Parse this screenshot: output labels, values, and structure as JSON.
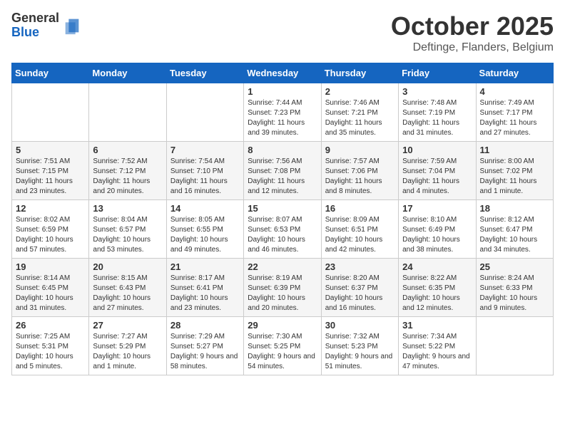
{
  "logo": {
    "general": "General",
    "blue": "Blue"
  },
  "header": {
    "month": "October 2025",
    "location": "Deftinge, Flanders, Belgium"
  },
  "days_of_week": [
    "Sunday",
    "Monday",
    "Tuesday",
    "Wednesday",
    "Thursday",
    "Friday",
    "Saturday"
  ],
  "weeks": [
    [
      {
        "day": "",
        "info": ""
      },
      {
        "day": "",
        "info": ""
      },
      {
        "day": "",
        "info": ""
      },
      {
        "day": "1",
        "info": "Sunrise: 7:44 AM\nSunset: 7:23 PM\nDaylight: 11 hours\nand 39 minutes."
      },
      {
        "day": "2",
        "info": "Sunrise: 7:46 AM\nSunset: 7:21 PM\nDaylight: 11 hours\nand 35 minutes."
      },
      {
        "day": "3",
        "info": "Sunrise: 7:48 AM\nSunset: 7:19 PM\nDaylight: 11 hours\nand 31 minutes."
      },
      {
        "day": "4",
        "info": "Sunrise: 7:49 AM\nSunset: 7:17 PM\nDaylight: 11 hours\nand 27 minutes."
      }
    ],
    [
      {
        "day": "5",
        "info": "Sunrise: 7:51 AM\nSunset: 7:15 PM\nDaylight: 11 hours\nand 23 minutes."
      },
      {
        "day": "6",
        "info": "Sunrise: 7:52 AM\nSunset: 7:12 PM\nDaylight: 11 hours\nand 20 minutes."
      },
      {
        "day": "7",
        "info": "Sunrise: 7:54 AM\nSunset: 7:10 PM\nDaylight: 11 hours\nand 16 minutes."
      },
      {
        "day": "8",
        "info": "Sunrise: 7:56 AM\nSunset: 7:08 PM\nDaylight: 11 hours\nand 12 minutes."
      },
      {
        "day": "9",
        "info": "Sunrise: 7:57 AM\nSunset: 7:06 PM\nDaylight: 11 hours\nand 8 minutes."
      },
      {
        "day": "10",
        "info": "Sunrise: 7:59 AM\nSunset: 7:04 PM\nDaylight: 11 hours\nand 4 minutes."
      },
      {
        "day": "11",
        "info": "Sunrise: 8:00 AM\nSunset: 7:02 PM\nDaylight: 11 hours\nand 1 minute."
      }
    ],
    [
      {
        "day": "12",
        "info": "Sunrise: 8:02 AM\nSunset: 6:59 PM\nDaylight: 10 hours\nand 57 minutes."
      },
      {
        "day": "13",
        "info": "Sunrise: 8:04 AM\nSunset: 6:57 PM\nDaylight: 10 hours\nand 53 minutes."
      },
      {
        "day": "14",
        "info": "Sunrise: 8:05 AM\nSunset: 6:55 PM\nDaylight: 10 hours\nand 49 minutes."
      },
      {
        "day": "15",
        "info": "Sunrise: 8:07 AM\nSunset: 6:53 PM\nDaylight: 10 hours\nand 46 minutes."
      },
      {
        "day": "16",
        "info": "Sunrise: 8:09 AM\nSunset: 6:51 PM\nDaylight: 10 hours\nand 42 minutes."
      },
      {
        "day": "17",
        "info": "Sunrise: 8:10 AM\nSunset: 6:49 PM\nDaylight: 10 hours\nand 38 minutes."
      },
      {
        "day": "18",
        "info": "Sunrise: 8:12 AM\nSunset: 6:47 PM\nDaylight: 10 hours\nand 34 minutes."
      }
    ],
    [
      {
        "day": "19",
        "info": "Sunrise: 8:14 AM\nSunset: 6:45 PM\nDaylight: 10 hours\nand 31 minutes."
      },
      {
        "day": "20",
        "info": "Sunrise: 8:15 AM\nSunset: 6:43 PM\nDaylight: 10 hours\nand 27 minutes."
      },
      {
        "day": "21",
        "info": "Sunrise: 8:17 AM\nSunset: 6:41 PM\nDaylight: 10 hours\nand 23 minutes."
      },
      {
        "day": "22",
        "info": "Sunrise: 8:19 AM\nSunset: 6:39 PM\nDaylight: 10 hours\nand 20 minutes."
      },
      {
        "day": "23",
        "info": "Sunrise: 8:20 AM\nSunset: 6:37 PM\nDaylight: 10 hours\nand 16 minutes."
      },
      {
        "day": "24",
        "info": "Sunrise: 8:22 AM\nSunset: 6:35 PM\nDaylight: 10 hours\nand 12 minutes."
      },
      {
        "day": "25",
        "info": "Sunrise: 8:24 AM\nSunset: 6:33 PM\nDaylight: 10 hours\nand 9 minutes."
      }
    ],
    [
      {
        "day": "26",
        "info": "Sunrise: 7:25 AM\nSunset: 5:31 PM\nDaylight: 10 hours\nand 5 minutes."
      },
      {
        "day": "27",
        "info": "Sunrise: 7:27 AM\nSunset: 5:29 PM\nDaylight: 10 hours\nand 1 minute."
      },
      {
        "day": "28",
        "info": "Sunrise: 7:29 AM\nSunset: 5:27 PM\nDaylight: 9 hours\nand 58 minutes."
      },
      {
        "day": "29",
        "info": "Sunrise: 7:30 AM\nSunset: 5:25 PM\nDaylight: 9 hours\nand 54 minutes."
      },
      {
        "day": "30",
        "info": "Sunrise: 7:32 AM\nSunset: 5:23 PM\nDaylight: 9 hours\nand 51 minutes."
      },
      {
        "day": "31",
        "info": "Sunrise: 7:34 AM\nSunset: 5:22 PM\nDaylight: 9 hours\nand 47 minutes."
      },
      {
        "day": "",
        "info": ""
      }
    ]
  ]
}
